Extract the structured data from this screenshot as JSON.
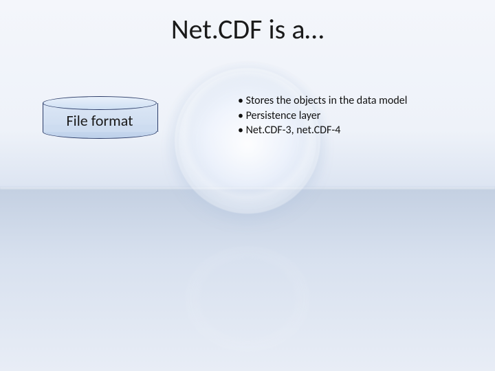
{
  "title": "Net.CDF is a…",
  "cylinder": {
    "label": "File format"
  },
  "bullets": {
    "items": [
      "Stores the objects in the data model",
      "Persistence layer",
      "Net.CDF-3, net.CDF-4"
    ]
  }
}
